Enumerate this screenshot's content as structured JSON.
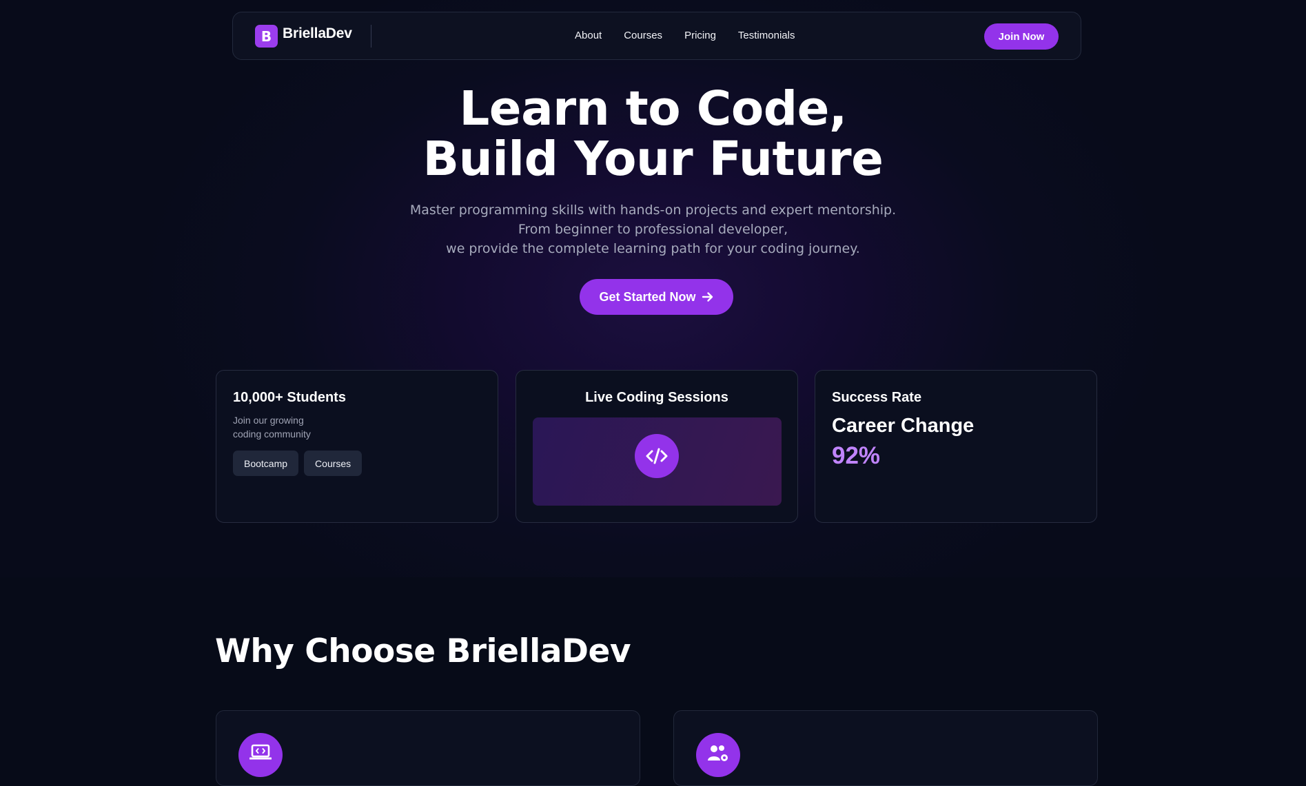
{
  "nav": {
    "logo_letter": "B",
    "brand": "BriellaDev",
    "links": [
      "About",
      "Courses",
      "Pricing",
      "Testimonials"
    ],
    "join_label": "Join Now"
  },
  "hero": {
    "title_line1": "Learn to Code,",
    "title_line2": "Build Your Future",
    "subtitle_line1": "Master programming skills with hands-on projects and expert mentorship.",
    "subtitle_line2": "From beginner to professional developer,",
    "subtitle_line3": "we provide the complete learning path for your coding journey.",
    "cta_label": "Get Started Now",
    "cta_icon": "arrow-right-icon"
  },
  "cards": {
    "students": {
      "title": "10,000+ Students",
      "desc_line1": "Join our growing",
      "desc_line2": "coding community",
      "tags": [
        "Bootcamp",
        "Courses"
      ]
    },
    "live": {
      "title": "Live Coding Sessions",
      "icon": "code-icon"
    },
    "success": {
      "title": "Success Rate",
      "headline": "Career Change",
      "value": "92%"
    }
  },
  "why": {
    "title": "Why Choose BriellaDev",
    "features": [
      {
        "icon": "laptop-code-icon"
      },
      {
        "icon": "users-gear-icon"
      }
    ]
  },
  "colors": {
    "accent": "#9333ea",
    "accent_light": "#c084fc",
    "background": "#070b18",
    "card": "#0b0f1f"
  }
}
